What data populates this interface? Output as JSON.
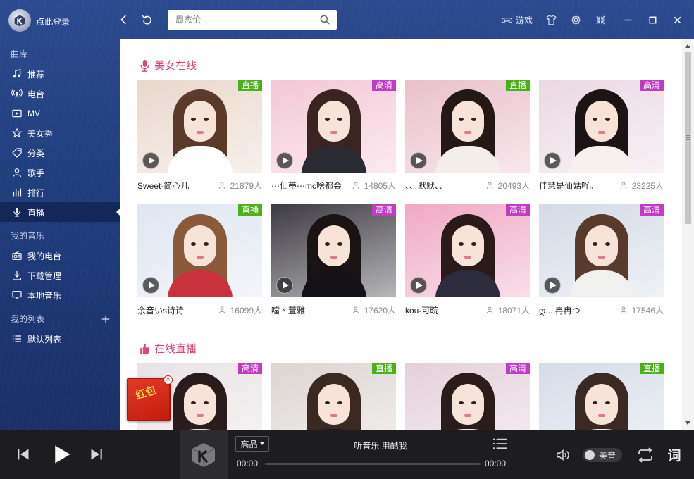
{
  "header": {
    "login_label": "点此登录",
    "search": {
      "value": "",
      "placeholder": "周杰伦"
    },
    "game_label": "游戏"
  },
  "sidebar": {
    "library_label": "曲库",
    "library_items": [
      {
        "label": "推荐",
        "icon": "music-note-icon"
      },
      {
        "label": "电台",
        "icon": "radio-icon"
      },
      {
        "label": "MV",
        "icon": "mv-icon"
      },
      {
        "label": "美女秀",
        "icon": "star-icon"
      },
      {
        "label": "分类",
        "icon": "tag-icon"
      },
      {
        "label": "歌手",
        "icon": "user-icon"
      },
      {
        "label": "排行",
        "icon": "ranking-icon"
      },
      {
        "label": "直播",
        "icon": "microphone-icon",
        "active": true
      }
    ],
    "my_music_label": "我的音乐",
    "my_music_items": [
      {
        "label": "我的电台",
        "icon": "my-radio-icon"
      },
      {
        "label": "下载管理",
        "icon": "download-icon"
      },
      {
        "label": "本地音乐",
        "icon": "monitor-icon"
      }
    ],
    "my_playlists_label": "我的列表",
    "playlist_items": [
      {
        "label": "默认列表",
        "icon": "list-icon"
      }
    ]
  },
  "sections": [
    {
      "title": "美女在线",
      "icon": "microphone-icon",
      "cards": [
        {
          "name": "Sweet-简心儿",
          "count": "21879人",
          "badge": "直播",
          "badge_type": "live",
          "colors": {
            "bg": "#e9d8cc",
            "hair": "#5b3a2a",
            "body": "#ffffff"
          }
        },
        {
          "name": "⋯仙蒂⋯mc啥都会",
          "count": "14805人",
          "badge": "高清",
          "badge_type": "hd",
          "colors": {
            "bg": "#f4c7d7",
            "hair": "#3a2320",
            "body": "#2b2b33"
          }
        },
        {
          "name": "、、默默、、",
          "count": "20493人",
          "badge": "直播",
          "badge_type": "live",
          "colors": {
            "bg": "#e9c0cc",
            "hair": "#231816",
            "body": "#f4eeea"
          }
        },
        {
          "name": "佳慧是仙姑吖。",
          "count": "23225人",
          "badge": "高清",
          "badge_type": "hd",
          "colors": {
            "bg": "#ead9e2",
            "hair": "#1c1414",
            "body": "#f6f1ef"
          }
        },
        {
          "name": "余音いs诗诗",
          "count": "16099人",
          "badge": "直播",
          "badge_type": "live",
          "colors": {
            "bg": "#dfe6f1",
            "hair": "#8a5a3a",
            "body": "#c8323c"
          }
        },
        {
          "name": "噹丶萱雅",
          "count": "17620人",
          "badge": "高清",
          "badge_type": "hd",
          "colors": {
            "bg": "#3d3b42",
            "hair": "#1a1313",
            "body": "#141216"
          }
        },
        {
          "name": "kou-可晥",
          "count": "18071人",
          "badge": "高清",
          "badge_type": "hd",
          "colors": {
            "bg": "#f0a9c4",
            "hair": "#2a1a1a",
            "body": "#2c2c3c"
          }
        },
        {
          "name": "ღ....冉冉つ",
          "count": "17546人",
          "badge": "高清",
          "badge_type": "hd",
          "colors": {
            "bg": "#d4dbe6",
            "hair": "#5a3b2b",
            "body": "#f0f0ee"
          }
        }
      ]
    },
    {
      "title": "在线直播",
      "icon": "thumb-up-icon",
      "cards": [
        {
          "badge": "高清",
          "badge_type": "hd",
          "colors": {
            "bg": "#e9e3e6",
            "hair": "#2a1c1c",
            "body": "#dfe8f3"
          }
        },
        {
          "badge": "直播",
          "badge_type": "live",
          "colors": {
            "bg": "#dcd6d2",
            "hair": "#3a2822",
            "body": "#1d1a1f"
          }
        },
        {
          "badge": "高清",
          "badge_type": "hd",
          "colors": {
            "bg": "#e4d1da",
            "hair": "#2b1c1c",
            "body": "#f0e6e8"
          }
        },
        {
          "badge": "直播",
          "badge_type": "live",
          "colors": {
            "bg": "#d6dde8",
            "hair": "#3b2a24",
            "body": "#f1ece8"
          }
        }
      ]
    }
  ],
  "red_packet": {
    "label": "红包"
  },
  "player": {
    "quality_label": "高品",
    "song_title": "听音乐 用酷我",
    "time_current": "00:00",
    "time_total": "00:00",
    "progress": 0,
    "beauty_label": "美音",
    "lyrics_label": "词"
  },
  "theme": {
    "accent_pink": "#e0447c",
    "badge_live": "#4caf1c",
    "badge_hd": "#c03cc5",
    "sidebar_blue": "#21407f"
  }
}
